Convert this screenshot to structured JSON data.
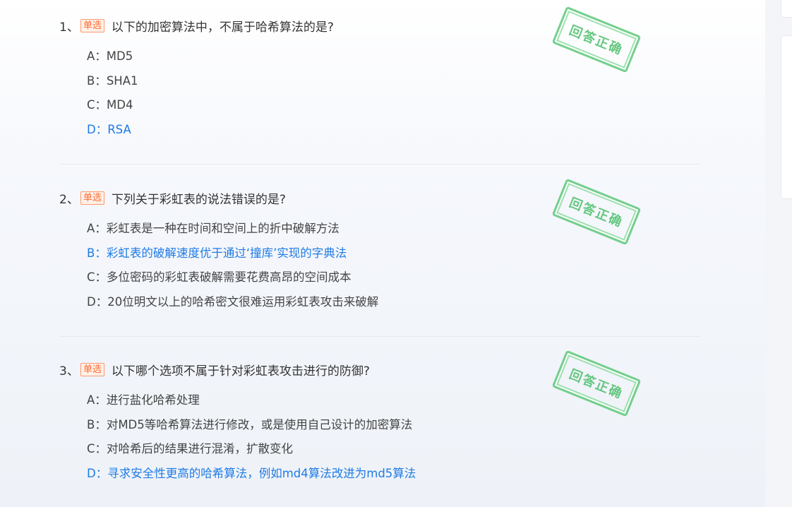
{
  "questions": [
    {
      "number": "1、",
      "type_badge": "单选",
      "text": "以下的加密算法中，不属于哈希算法的是?",
      "stamp": "回答正确",
      "options": [
        {
          "label": "A：MD5",
          "correct": false
        },
        {
          "label": "B：SHA1",
          "correct": false
        },
        {
          "label": "C：MD4",
          "correct": false
        },
        {
          "label": "D：RSA",
          "correct": true
        }
      ]
    },
    {
      "number": "2、",
      "type_badge": "单选",
      "text": "下列关于彩虹表的说法错误的是?",
      "stamp": "回答正确",
      "options": [
        {
          "label": "A：彩虹表是一种在时间和空间上的折中破解方法",
          "correct": false
        },
        {
          "label": "B：彩虹表的破解速度优于通过‘撞库’实现的字典法",
          "correct": true
        },
        {
          "label": "C：多位密码的彩虹表破解需要花费高昂的空间成本",
          "correct": false
        },
        {
          "label": "D：20位明文以上的哈希密文很难运用彩虹表攻击来破解",
          "correct": false
        }
      ]
    },
    {
      "number": "3、",
      "type_badge": "单选",
      "text": "以下哪个选项不属于针对彩虹表攻击进行的防御?",
      "stamp": "回答正确",
      "options": [
        {
          "label": "A：进行盐化哈希处理",
          "correct": false
        },
        {
          "label": "B：对MD5等哈希算法进行修改，或是使用自己设计的加密算法",
          "correct": false
        },
        {
          "label": "C：对哈希后的结果进行混淆，扩散变化",
          "correct": false
        },
        {
          "label": "D：寻求安全性更高的哈希算法，例如md4算法改进为md5算法",
          "correct": true
        }
      ]
    }
  ]
}
